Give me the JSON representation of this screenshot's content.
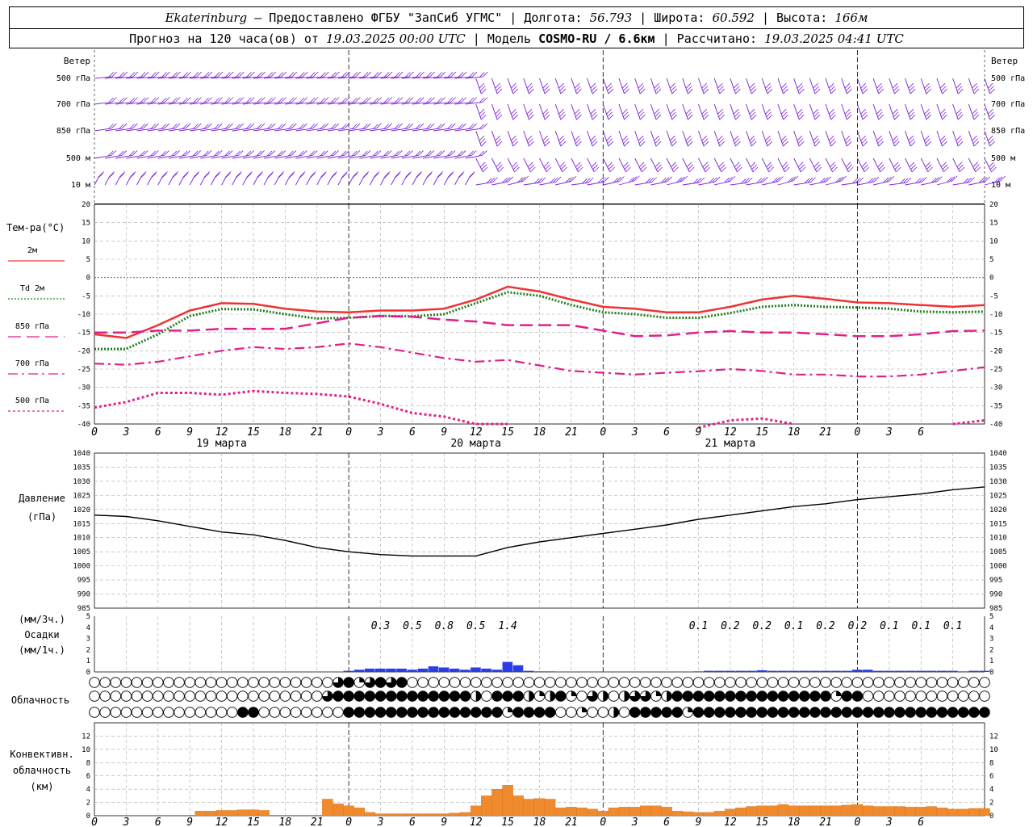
{
  "header": {
    "city": "Ekaterinburg",
    "provider": " — Предоставлено ФГБУ \"ЗапСиб УГМС\" | Долгота: ",
    "lon": "56.793",
    "lat_label": " | Широта: ",
    "lat": "60.592",
    "alt_label": " | Высота: ",
    "alt": "166м",
    "forecast_text": "Прогноз на 120 часа(ов) от ",
    "forecast_from": "19.03.2025 00:00 UTC",
    "model_label": " | Модель ",
    "model": "COSMO-RU / 6.6км",
    "calc_label": " | Рассчитано: ",
    "calc_time": "19.03.2025 04:41 UTC"
  },
  "time_axis": {
    "hour_labels": [
      "0",
      "3",
      "6",
      "9",
      "12",
      "15",
      "18",
      "21",
      "0",
      "3",
      "6",
      "9",
      "12",
      "15",
      "18",
      "21",
      "0",
      "3",
      "6",
      "9",
      "12",
      "15",
      "18",
      "21",
      "0",
      "3",
      "6"
    ],
    "day_labels": [
      {
        "text": "19 марта",
        "hour": 12
      },
      {
        "text": "20 марта",
        "hour": 36
      },
      {
        "text": "21 марта",
        "hour": 60
      }
    ]
  },
  "wind": {
    "title": "Ветер",
    "levels": [
      "500 гПа",
      "700 гПа",
      "850 гПа",
      "500 м",
      "10  м"
    ],
    "color": "#7a1fd6"
  },
  "temperature": {
    "title": "Тем-ра(°С)",
    "ylim": [
      -40,
      20
    ],
    "ticks": [
      "20",
      "15",
      "10",
      "5",
      "0",
      "-5",
      "-10",
      "-15",
      "-20",
      "-25",
      "-30",
      "-35",
      "-40"
    ],
    "legend": [
      {
        "label": "2м",
        "color": "#ee3333",
        "style": "solid"
      },
      {
        "label": "Td 2м",
        "color": "#207d20",
        "style": "dotted"
      },
      {
        "label": "850 гПа",
        "color": "#e0208a",
        "style": "dash"
      },
      {
        "label": "700 гПа",
        "color": "#e0208a",
        "style": "dashdot"
      },
      {
        "label": "500 гПа",
        "color": "#e0208a",
        "style": "dot"
      }
    ]
  },
  "pressure": {
    "title": "Давление",
    "unit": "(гПа)",
    "ylim": [
      985,
      1040
    ],
    "ticks": [
      "1040",
      "1035",
      "1030",
      "1025",
      "1020",
      "1015",
      "1010",
      "1005",
      "1000",
      "995",
      "990",
      "985"
    ]
  },
  "precip": {
    "unit3": "(мм/3ч.)",
    "title": "Осадки",
    "unit1": "(мм/1ч.)",
    "ticks": [
      "5",
      "4",
      "3",
      "2",
      "1",
      "0"
    ],
    "color": "#2a3ee8",
    "labels": [
      {
        "hour": 27,
        "text": "0.3"
      },
      {
        "hour": 30,
        "text": "0.5"
      },
      {
        "hour": 33,
        "text": "0.8"
      },
      {
        "hour": 36,
        "text": "0.5"
      },
      {
        "hour": 39,
        "text": "1.4"
      },
      {
        "hour": 57,
        "text": "0.1"
      },
      {
        "hour": 60,
        "text": "0.2"
      },
      {
        "hour": 63,
        "text": "0.2"
      },
      {
        "hour": 66,
        "text": "0.1"
      },
      {
        "hour": 69,
        "text": "0.2"
      },
      {
        "hour": 72,
        "text": "0.2"
      },
      {
        "hour": 75,
        "text": "0.1"
      },
      {
        "hour": 78,
        "text": "0.1"
      },
      {
        "hour": 81,
        "text": "0.1"
      }
    ]
  },
  "cloud": {
    "title": "Облачность"
  },
  "convective": {
    "title1": "Конвективн.",
    "title2": "облачность",
    "unit": "(км)",
    "ticks": [
      "12",
      "10",
      "8",
      "6",
      "4",
      "2",
      "0"
    ],
    "color": "#f08a2e"
  },
  "chart_data": [
    {
      "type": "line",
      "title": "Тем-ра(°С)",
      "ylim": [
        -40,
        20
      ],
      "x_hours": [
        0,
        3,
        6,
        9,
        12,
        15,
        18,
        21,
        24,
        27,
        30,
        33,
        36,
        39,
        42,
        45,
        48,
        51,
        54,
        57,
        60,
        63,
        66,
        69,
        72,
        75,
        78,
        81,
        84
      ],
      "series": [
        {
          "name": "2м",
          "values": [
            -15.5,
            -16.5,
            -13,
            -9,
            -7,
            -7.2,
            -8.5,
            -9.3,
            -9.5,
            -9,
            -9,
            -8.5,
            -6,
            -2.5,
            -3.8,
            -6,
            -8,
            -8.5,
            -9.5,
            -9.5,
            -8,
            -6,
            -5,
            -5.8,
            -6.8,
            -7,
            -7.5,
            -8,
            -7.5
          ]
        },
        {
          "name": "Td 2м",
          "values": [
            -19.5,
            -19.5,
            -15.5,
            -10.5,
            -8.6,
            -8.7,
            -10,
            -11.2,
            -11,
            -10.5,
            -10.6,
            -10,
            -7,
            -4,
            -5,
            -7.5,
            -9.5,
            -10,
            -11,
            -11,
            -9.7,
            -8,
            -7.5,
            -8,
            -8.2,
            -8.5,
            -9.3,
            -9.5,
            -9.3
          ]
        },
        {
          "name": "850 гПа",
          "values": [
            -15,
            -15,
            -14.5,
            -14.5,
            -14,
            -14,
            -14,
            -12.5,
            -11,
            -10.5,
            -10.7,
            -11.5,
            -12,
            -13,
            -13,
            -13,
            -14.5,
            -16,
            -15.8,
            -15,
            -14.6,
            -15,
            -15,
            -15.5,
            -16,
            -16,
            -15.5,
            -14.6,
            -14.5
          ]
        },
        {
          "name": "700 гПа",
          "values": [
            -23.5,
            -23.8,
            -23,
            -21.5,
            -20,
            -19,
            -19.5,
            -19,
            -18,
            -19,
            -20.5,
            -22,
            -23,
            -22.5,
            -24,
            -25.5,
            -26,
            -26.5,
            -26,
            -25.6,
            -25,
            -25.5,
            -26.5,
            -26.5,
            -27,
            -27,
            -26.5,
            -25.5,
            -24.5
          ]
        },
        {
          "name": "500 гПа",
          "values": [
            -35.5,
            -34,
            -31.5,
            -31.5,
            -32,
            -31,
            -31.5,
            -31.8,
            -32.5,
            -34.5,
            -37,
            -38,
            -40,
            -40,
            null,
            null,
            null,
            null,
            null,
            -41,
            -39,
            -38.5,
            -40,
            null,
            null,
            null,
            null,
            -40,
            -39
          ]
        }
      ]
    },
    {
      "type": "line",
      "title": "Давление",
      "ylim": [
        985,
        1040
      ],
      "x_hours": [
        0,
        3,
        6,
        9,
        12,
        15,
        18,
        21,
        24,
        27,
        30,
        33,
        36,
        39,
        42,
        45,
        48,
        51,
        54,
        57,
        60,
        63,
        66,
        69,
        72,
        75,
        78,
        81,
        84
      ],
      "series": [
        {
          "name": "Давление",
          "values": [
            1018,
            1017.5,
            1016,
            1014,
            1012,
            1011,
            1009,
            1006.5,
            1005,
            1004,
            1003.5,
            1003.5,
            1003.5,
            1006.5,
            1008.5,
            1010,
            1011.5,
            1013,
            1014.5,
            1016.5,
            1018,
            1019.5,
            1021,
            1022,
            1023.5,
            1024.5,
            1025.5,
            1027,
            1028
          ]
        }
      ]
    },
    {
      "type": "bar",
      "title": "Осадки",
      "unit": "мм/1ч.",
      "x_hours": [
        24,
        25,
        26,
        27,
        28,
        29,
        30,
        31,
        32,
        33,
        34,
        35,
        36,
        37,
        38,
        39,
        40,
        41,
        42,
        43,
        57,
        58,
        59,
        60,
        61,
        62,
        63,
        64,
        65,
        66,
        67,
        68,
        69,
        70,
        71,
        72,
        73,
        74,
        75,
        76,
        77,
        78,
        79,
        80,
        81,
        82,
        83,
        84
      ],
      "values": [
        0.1,
        0.2,
        0.3,
        0.3,
        0.3,
        0.3,
        0.2,
        0.3,
        0.5,
        0.4,
        0.3,
        0.2,
        0.4,
        0.3,
        0.2,
        0.9,
        0.6,
        0.1,
        0.05,
        0.05,
        0.05,
        0.1,
        0.1,
        0.1,
        0.1,
        0.1,
        0.15,
        0.1,
        0.1,
        0.1,
        0.1,
        0.1,
        0.1,
        0.1,
        0.1,
        0.2,
        0.2,
        0.1,
        0.1,
        0.1,
        0.1,
        0.1,
        0.1,
        0.1,
        0.1,
        0.05,
        0.1,
        0.1
      ]
    },
    {
      "type": "table",
      "title": "Облачность",
      "note": "cloud cover per hour: 0 clear ... 4 overcast; rows top=upper, bottom=lower",
      "rows": [
        [
          0,
          0,
          0,
          0,
          0,
          0,
          0,
          0,
          0,
          0,
          0,
          0,
          0,
          0,
          0,
          0,
          0,
          0,
          0,
          0,
          0,
          0,
          0,
          3,
          4,
          1,
          3,
          4,
          3,
          4,
          0,
          0,
          0,
          0,
          0,
          0,
          0,
          0,
          0,
          0,
          0,
          0,
          0,
          0,
          0,
          0,
          0,
          0,
          0,
          0,
          0,
          0,
          0,
          0,
          0,
          0,
          0,
          0,
          0,
          0,
          0,
          0,
          0,
          0,
          0,
          0,
          0,
          0,
          0,
          0,
          0,
          0,
          0,
          0,
          0,
          0,
          0,
          0,
          0,
          0,
          0,
          0,
          0,
          0,
          0
        ],
        [
          0,
          0,
          0,
          0,
          0,
          0,
          0,
          0,
          0,
          0,
          0,
          0,
          0,
          0,
          0,
          0,
          0,
          0,
          0,
          0,
          0,
          0,
          3,
          4,
          4,
          4,
          4,
          4,
          4,
          4,
          4,
          4,
          4,
          4,
          4,
          4,
          2,
          0,
          4,
          4,
          4,
          2,
          1,
          2,
          4,
          1,
          0,
          3,
          2,
          0,
          2,
          3,
          3,
          1,
          2,
          4,
          4,
          4,
          4,
          4,
          4,
          4,
          4,
          4,
          4,
          4,
          4,
          4,
          4,
          4,
          1,
          4,
          4,
          0,
          0,
          0,
          0,
          0,
          0,
          0,
          0,
          0,
          0,
          0,
          0
        ],
        [
          0,
          0,
          0,
          0,
          0,
          0,
          0,
          0,
          0,
          0,
          0,
          0,
          0,
          0,
          4,
          4,
          0,
          0,
          0,
          0,
          0,
          0,
          0,
          0,
          4,
          4,
          4,
          4,
          4,
          4,
          4,
          4,
          4,
          4,
          4,
          4,
          4,
          4,
          4,
          1,
          4,
          4,
          4,
          4,
          0,
          0,
          1,
          0,
          0,
          2,
          0,
          4,
          4,
          4,
          4,
          4,
          1,
          4,
          4,
          4,
          4,
          4,
          4,
          4,
          4,
          4,
          4,
          4,
          4,
          4,
          4,
          4,
          4,
          4,
          4,
          4,
          4,
          4,
          4,
          4,
          4,
          4,
          4,
          4,
          4
        ]
      ]
    },
    {
      "type": "bar",
      "title": "Конвективн. облачность (км)",
      "x_hours": [
        10,
        11,
        12,
        13,
        14,
        15,
        16,
        22,
        23,
        24,
        25,
        26,
        27,
        28,
        29,
        30,
        31,
        32,
        33,
        34,
        35,
        36,
        37,
        38,
        39,
        40,
        41,
        42,
        43,
        44,
        45,
        46,
        47,
        48,
        49,
        50,
        51,
        52,
        53,
        54,
        55,
        56,
        57,
        58,
        59,
        60,
        61,
        62,
        63,
        64,
        65,
        66,
        67,
        68,
        69,
        70,
        71,
        72,
        73,
        74,
        75,
        76,
        77,
        78,
        79,
        80,
        81,
        82,
        83,
        84
      ],
      "values": [
        0.7,
        0.7,
        0.8,
        0.8,
        0.9,
        0.9,
        0.8,
        2.5,
        1.8,
        1.5,
        1.2,
        0.5,
        0.3,
        0.3,
        0.3,
        0.3,
        0.3,
        0.3,
        0.3,
        0.4,
        0.5,
        1.5,
        3,
        4,
        4.6,
        3,
        2.5,
        2.6,
        2.5,
        1.2,
        1.3,
        1.2,
        1,
        0.7,
        1.2,
        1.3,
        1.3,
        1.5,
        1.5,
        1.3,
        0.7,
        0.6,
        0.5,
        0.5,
        0.7,
        1,
        1.2,
        1.4,
        1.5,
        1.5,
        1.7,
        1.5,
        1.5,
        1.5,
        1.5,
        1.5,
        1.6,
        1.7,
        1.5,
        1.4,
        1.4,
        1.4,
        1.3,
        1.3,
        1.4,
        1.2,
        1,
        1,
        1.1,
        1.1
      ]
    }
  ]
}
